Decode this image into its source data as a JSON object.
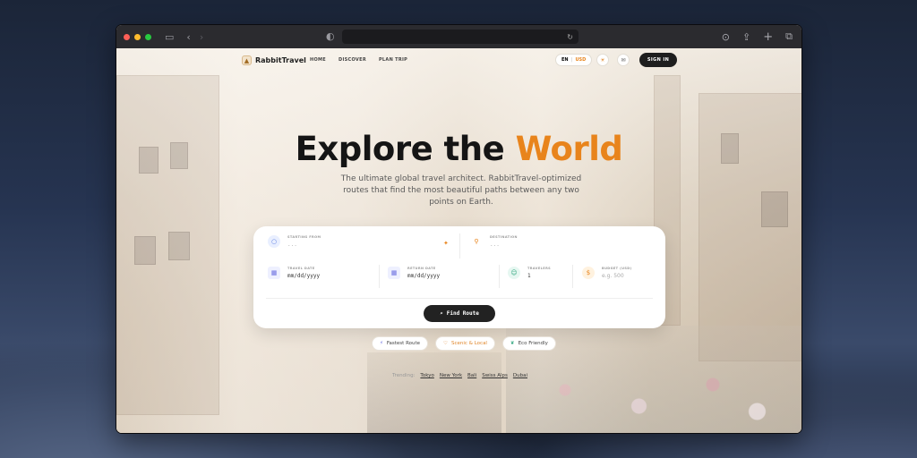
{
  "browser": {
    "url": "",
    "icons": [
      "sidebar-icon",
      "back-icon",
      "forward-icon",
      "shield-icon",
      "reload-icon",
      "download-icon",
      "share-icon",
      "new-tab-icon",
      "tabs-icon"
    ]
  },
  "nav": {
    "logo": "RabbitTravel",
    "links": [
      "HOME",
      "DISCOVER",
      "PLAN TRIP"
    ],
    "lang": "EN",
    "currency": "USD",
    "signin": "SIGN IN"
  },
  "hero": {
    "title_main": "Explore the",
    "title_accent": "World",
    "subtitle": "The ultimate global travel architect. RabbitTravel-optimized routes that find the most beautiful paths between any two points on Earth."
  },
  "search": {
    "from_label": "STARTING FROM",
    "from_value": "...",
    "to_label": "DESTINATION",
    "to_value": "...",
    "travel_date_label": "TRAVEL DATE",
    "travel_date_value": "mm/dd/yyyy",
    "return_date_label": "RETURN DATE",
    "return_date_value": "mm/dd/yyyy",
    "travelers_label": "TRAVELERS",
    "travelers_value": "1",
    "budget_label": "BUDGET (USD)",
    "budget_placeholder": "e.g. 500",
    "find_button": "Find Route"
  },
  "chips": [
    "Fastest Route",
    "Scenic & Local",
    "Eco Friendly"
  ],
  "trending": {
    "label": "Trending:",
    "cities": [
      "Tokyo",
      "New York",
      "Bali",
      "Swiss Alps",
      "Dubai"
    ]
  },
  "colors": {
    "accent": "#e8841c",
    "dark": "#1e1e1e",
    "card": "#ffffff"
  }
}
